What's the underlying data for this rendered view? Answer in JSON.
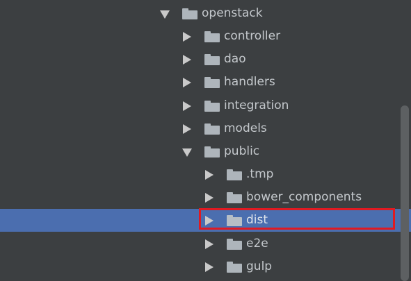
{
  "tree": {
    "items": [
      {
        "label": "openstack",
        "state": "expanded",
        "level": 0,
        "selected": false
      },
      {
        "label": "controller",
        "state": "collapsed",
        "level": 1,
        "selected": false
      },
      {
        "label": "dao",
        "state": "collapsed",
        "level": 1,
        "selected": false
      },
      {
        "label": "handlers",
        "state": "collapsed",
        "level": 1,
        "selected": false
      },
      {
        "label": "integration",
        "state": "collapsed",
        "level": 1,
        "selected": false
      },
      {
        "label": "models",
        "state": "collapsed",
        "level": 1,
        "selected": false
      },
      {
        "label": "public",
        "state": "expanded",
        "level": 1,
        "selected": false
      },
      {
        "label": ".tmp",
        "state": "collapsed",
        "level": 2,
        "selected": false
      },
      {
        "label": "bower_components",
        "state": "collapsed",
        "level": 2,
        "selected": false
      },
      {
        "label": "dist",
        "state": "collapsed",
        "level": 2,
        "selected": true
      },
      {
        "label": "e2e",
        "state": "collapsed",
        "level": 2,
        "selected": false
      },
      {
        "label": "gulp",
        "state": "collapsed",
        "level": 2,
        "selected": false
      }
    ]
  },
  "colors": {
    "background": "#3c3f41",
    "selection": "#4b6eaf",
    "highlight_border": "#e01a22",
    "text": "#c4c8cc",
    "folder": "#aeb5bb"
  }
}
